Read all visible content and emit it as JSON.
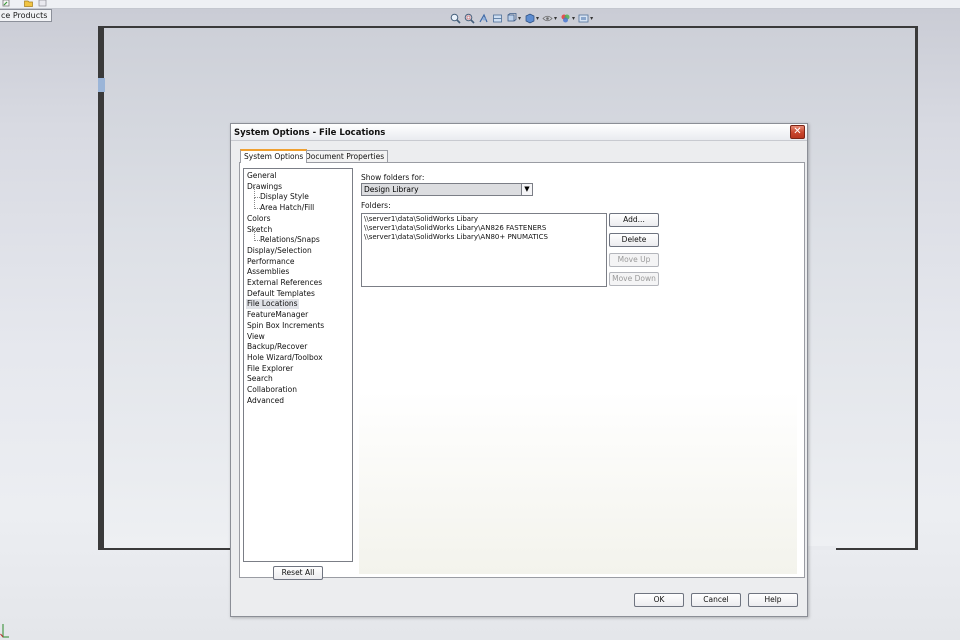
{
  "app": {
    "task_pane_tab": "ce Products"
  },
  "view_toolbar": {
    "icons": [
      "zoom-to-fit-icon",
      "zoom-area-icon",
      "previous-view-icon",
      "section-view-icon",
      "view-orientation-icon",
      "display-style-icon",
      "hide-show-icon",
      "edit-appearance-icon",
      "apply-scene-icon"
    ]
  },
  "dialog": {
    "title": "System Options - File Locations",
    "tabs": [
      {
        "label": "System Options",
        "active": true
      },
      {
        "label": "Document Properties",
        "active": false
      }
    ],
    "tree": [
      {
        "label": "General",
        "level": 0
      },
      {
        "label": "Drawings",
        "level": 0
      },
      {
        "label": "Display Style",
        "level": 1
      },
      {
        "label": "Area Hatch/Fill",
        "level": 1
      },
      {
        "label": "Colors",
        "level": 0
      },
      {
        "label": "Sketch",
        "level": 0
      },
      {
        "label": "Relations/Snaps",
        "level": 1
      },
      {
        "label": "Display/Selection",
        "level": 0
      },
      {
        "label": "Performance",
        "level": 0
      },
      {
        "label": "Assemblies",
        "level": 0
      },
      {
        "label": "External References",
        "level": 0
      },
      {
        "label": "Default Templates",
        "level": 0
      },
      {
        "label": "File Locations",
        "level": 0,
        "selected": true
      },
      {
        "label": "FeatureManager",
        "level": 0
      },
      {
        "label": "Spin Box Increments",
        "level": 0
      },
      {
        "label": "View",
        "level": 0
      },
      {
        "label": "Backup/Recover",
        "level": 0
      },
      {
        "label": "Hole Wizard/Toolbox",
        "level": 0
      },
      {
        "label": "File Explorer",
        "level": 0
      },
      {
        "label": "Search",
        "level": 0
      },
      {
        "label": "Collaboration",
        "level": 0
      },
      {
        "label": "Advanced",
        "level": 0
      }
    ],
    "reset_all": "Reset All",
    "show_folders_label": "Show folders for:",
    "show_folders_value": "Design Library",
    "folders_label": "Folders:",
    "folders": [
      "\\\\server1\\data\\SolidWorks Libary",
      "\\\\server1\\data\\SolidWorks Libary\\AN826 FASTENERS",
      "\\\\server1\\data\\SolidWorks Libary\\AN80+ PNUMATICS"
    ],
    "buttons": {
      "add": "Add...",
      "delete": "Delete",
      "move_up": "Move Up",
      "move_down": "Move Down"
    },
    "footer": {
      "ok": "OK",
      "cancel": "Cancel",
      "help": "Help"
    }
  },
  "colors": {
    "close_button": "#c8452c",
    "active_tab_accent": "#f0a030"
  }
}
